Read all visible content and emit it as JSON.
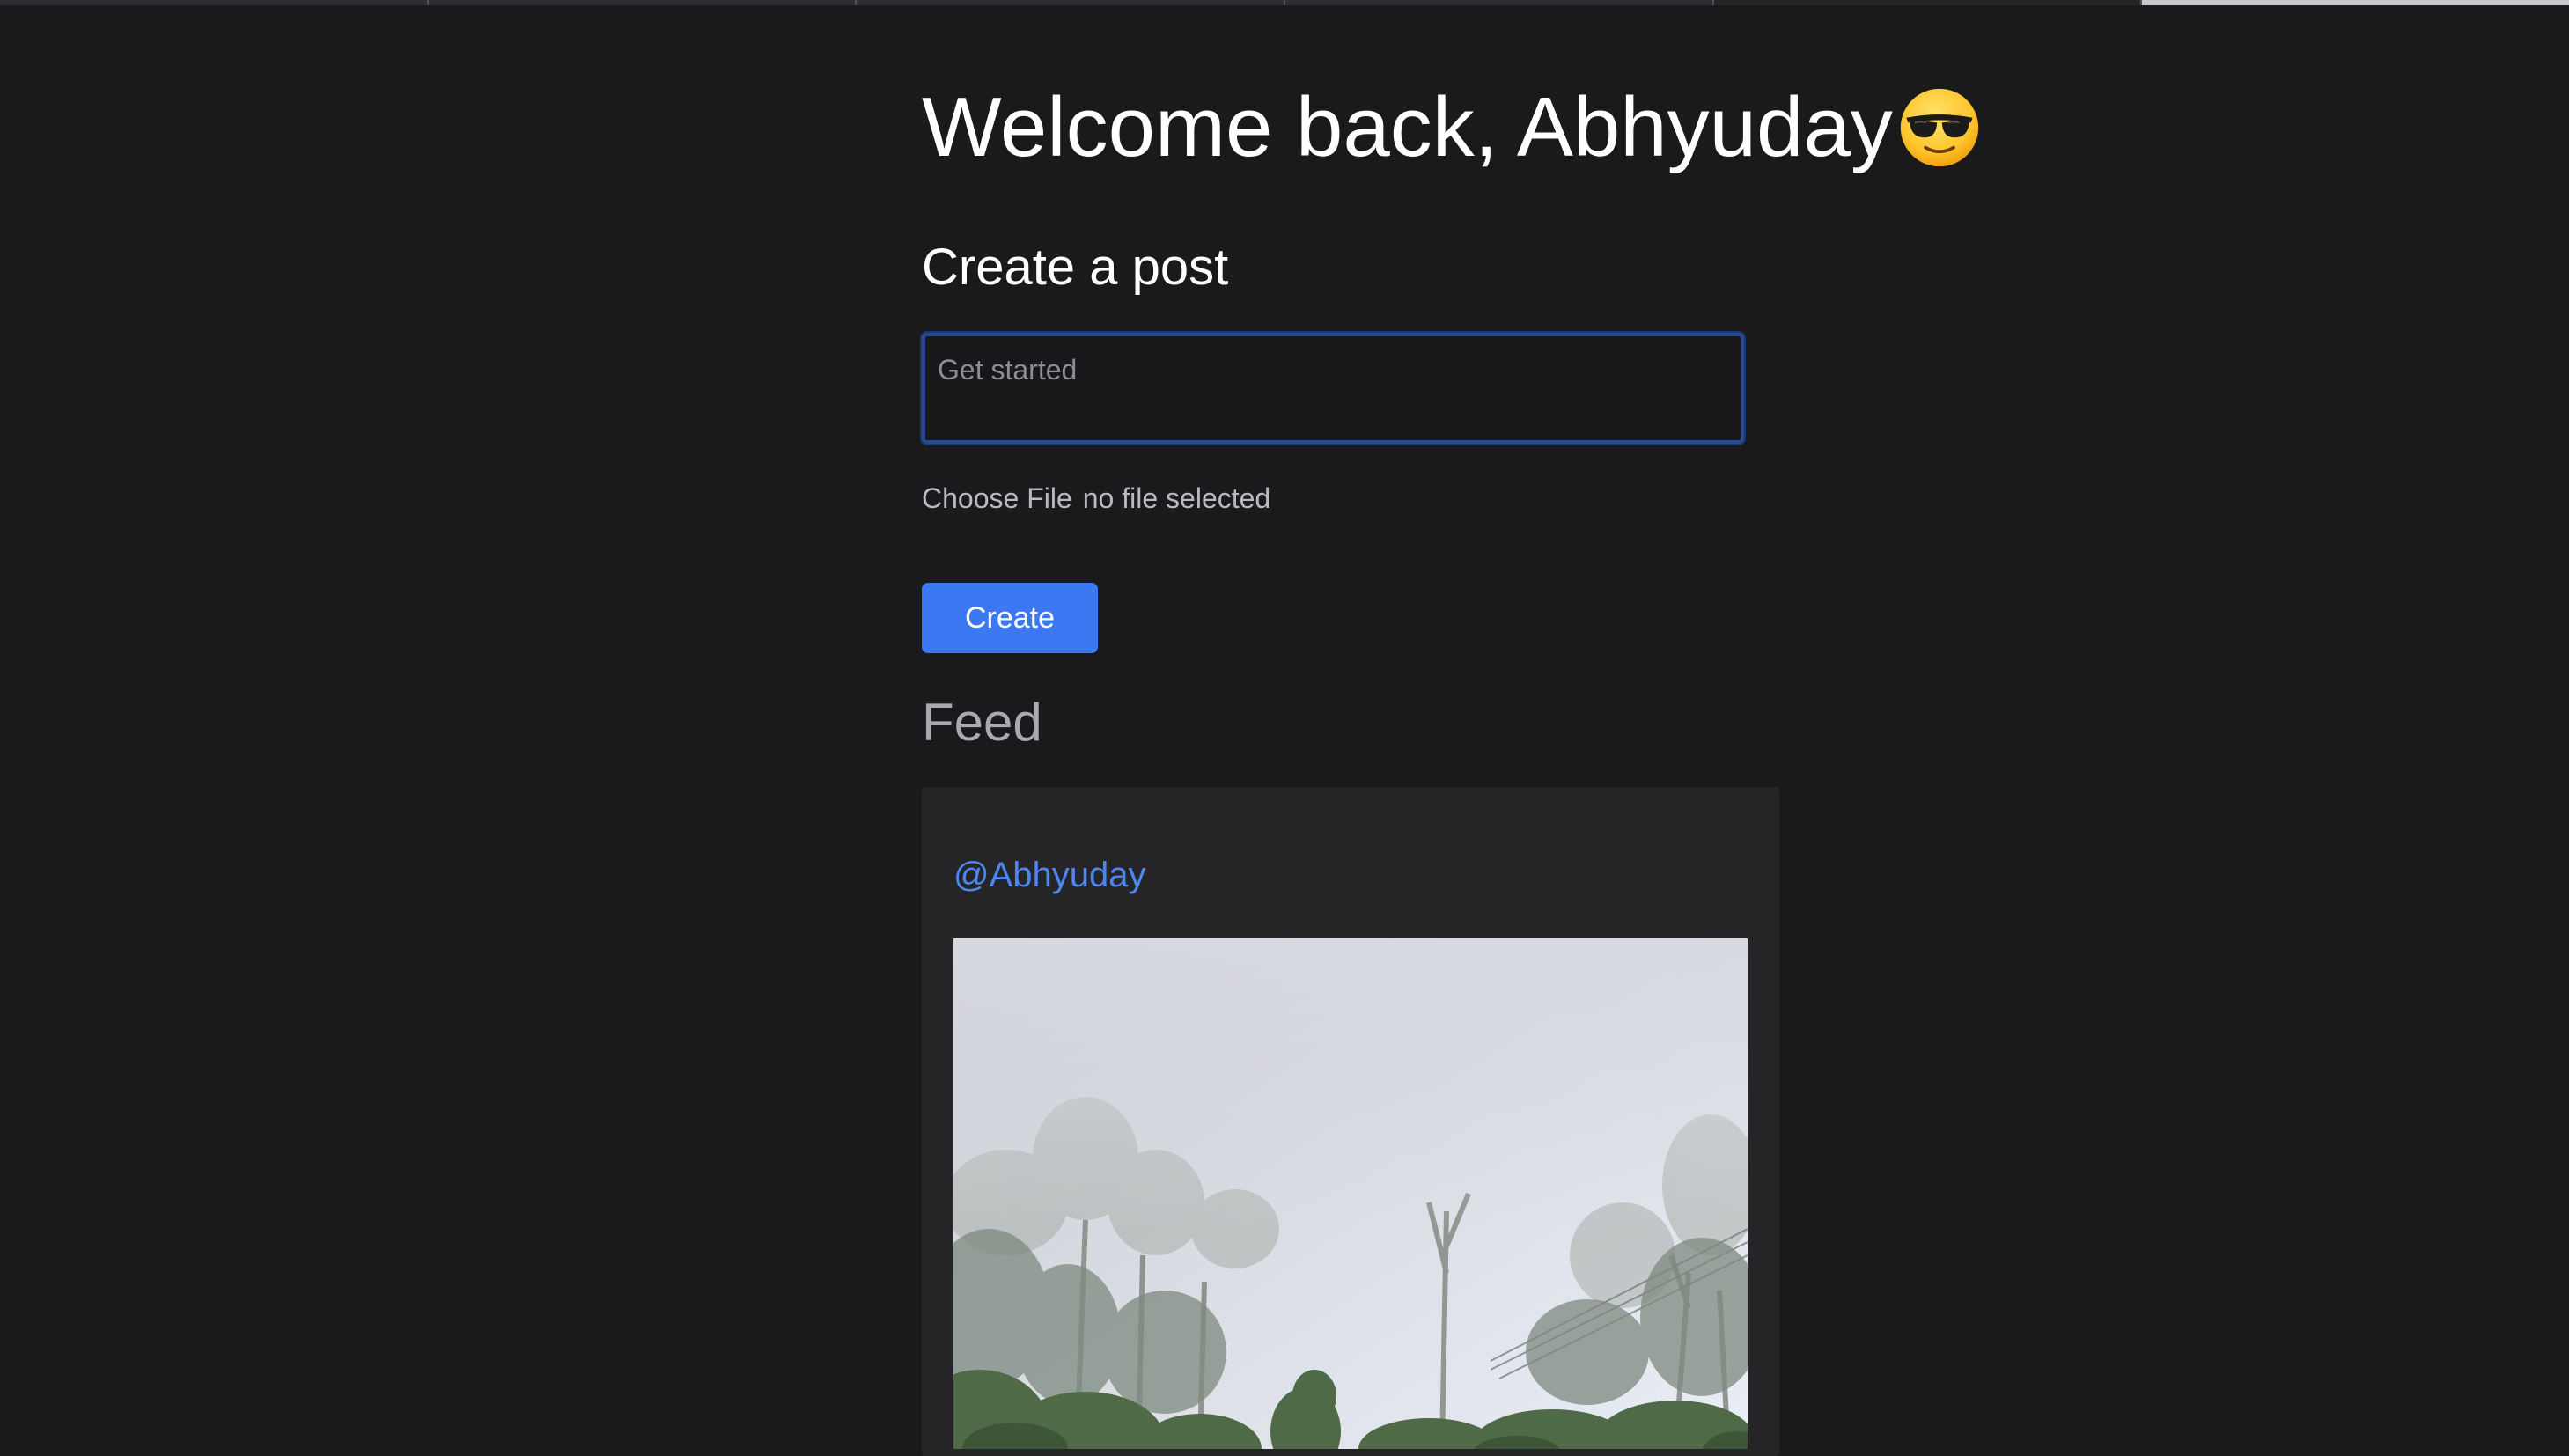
{
  "header": {
    "welcome_text": "Welcome back, Abhyuday",
    "welcome_emoji": "smiling-face-with-sunglasses-icon"
  },
  "create_post": {
    "heading": "Create a post",
    "input_placeholder": "Get started",
    "input_value": "",
    "file_button_label": "Choose File",
    "file_status": "no file selected",
    "submit_label": "Create"
  },
  "feed": {
    "heading": "Feed",
    "posts": [
      {
        "username": "@Abhyuday",
        "image": "misty-forest-photo"
      }
    ]
  },
  "colors": {
    "background": "#1a1a1d",
    "card": "#252528",
    "accent": "#3b78f2",
    "link": "#4c86f0",
    "input_border": "#2a4a8f"
  }
}
